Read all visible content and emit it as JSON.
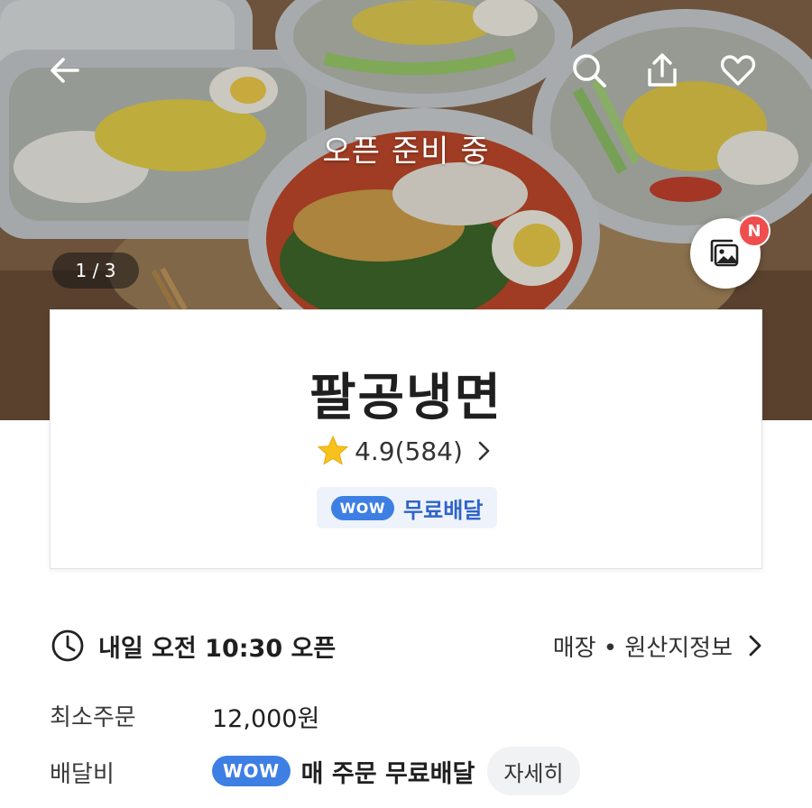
{
  "header": {
    "back_icon": "arrow-left-icon",
    "search_icon": "search-icon",
    "share_icon": "share-icon",
    "favorite_icon": "heart-icon",
    "status_text": "오픈 준비 중",
    "photo_counter": "1 / 3",
    "gallery_icon": "photo-gallery-icon",
    "new_badge": "N"
  },
  "store": {
    "name": "팔공냉면",
    "rating": "4.9(584)",
    "rating_icon": "star-icon",
    "wow_badge": "WOW",
    "wow_label": "무료배달"
  },
  "info": {
    "open_time": "내일 오전 10:30 오픈",
    "store_info_link": "매장 • 원산지정보",
    "min_order_label": "최소주문",
    "min_order_value": "12,000원",
    "delivery_fee_label": "배달비",
    "delivery_wow_badge": "WOW",
    "delivery_fee_value": "매 주문 무료배달",
    "detail_button": "자세히"
  },
  "colors": {
    "accent_blue": "#3e7fe4",
    "wow_text_blue": "#2f63c8",
    "badge_red": "#f04e4e",
    "star_yellow": "#f7c21b"
  }
}
